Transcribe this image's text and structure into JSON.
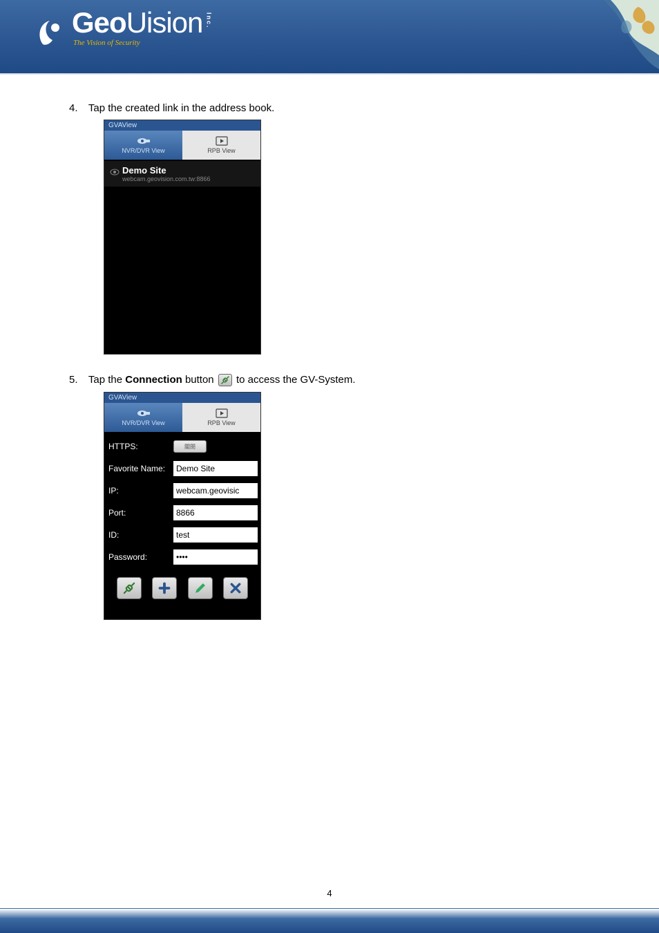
{
  "brand": {
    "name_a": "Geo",
    "name_b": "Uision",
    "inc": "Inc.",
    "tagline": "The Vision of Security"
  },
  "steps": {
    "s4_num": "4.",
    "s4_text": "Tap the created link in the address book.",
    "s5_num": "5.",
    "s5_a": "Tap the ",
    "s5_bold": "Connection",
    "s5_b": " button ",
    "s5_c": " to access the GV-System."
  },
  "shot": {
    "app_title": "GVAView",
    "tab1": "NVR/DVR View",
    "tab2": "RPB View",
    "li_title": "Demo Site",
    "li_sub": "webcam.geovision.com.tw:8866"
  },
  "form": {
    "l_https": "HTTPS:",
    "toggle": "關閉",
    "l_fav": "Favorite Name:",
    "v_fav": "Demo Site",
    "l_ip": "IP:",
    "v_ip": "webcam.geovisic",
    "l_port": "Port:",
    "v_port": "8866",
    "l_id": "ID:",
    "v_id": "test",
    "l_pw": "Password:",
    "v_pw": "••••"
  },
  "page_number": "4",
  "colors": {
    "brand_blue": "#2a5590"
  }
}
